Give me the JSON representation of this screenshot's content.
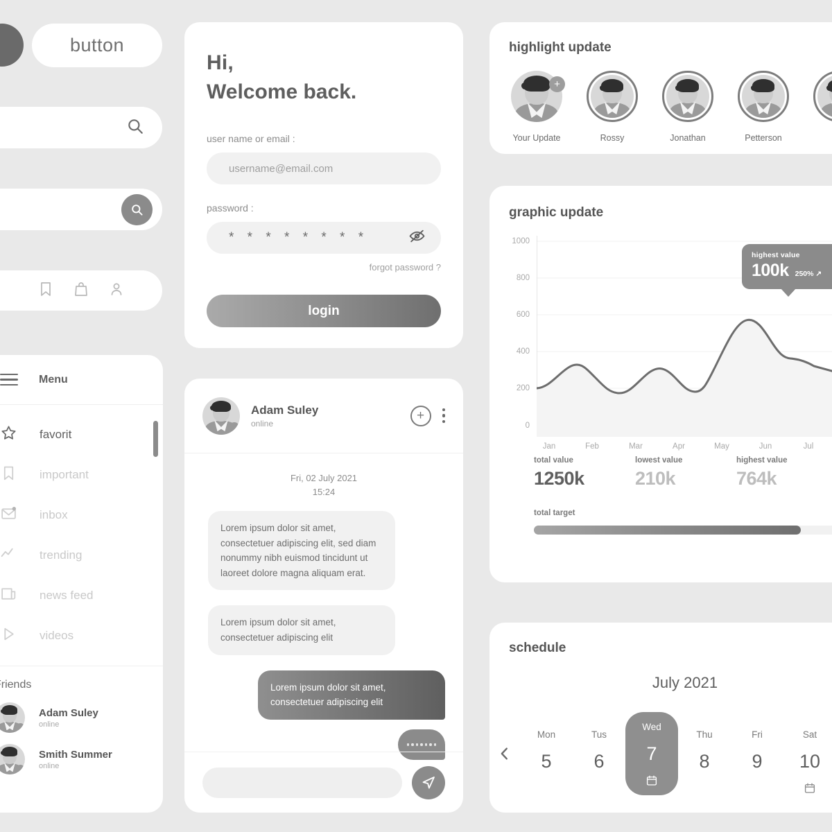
{
  "theme": {
    "bg": "#e9e9e9",
    "card": "#ffffff",
    "accent": "#8b8b8b",
    "text_dark": "#5e5e5e",
    "text_muted": "#a9a9a9"
  },
  "components": {
    "button_label": "button",
    "circle_icon": "dark-circle",
    "search_icon": "search-icon",
    "icon_bar": [
      {
        "name": "bookmark-icon"
      },
      {
        "name": "bag-icon"
      },
      {
        "name": "user-icon"
      }
    ]
  },
  "sidebar": {
    "menu_label": "Menu",
    "items": [
      {
        "label": "favorit",
        "icon": "star-icon",
        "active": true
      },
      {
        "label": "important",
        "icon": "bookmark-icon",
        "active": false
      },
      {
        "label": "inbox",
        "icon": "mail-icon",
        "active": false
      },
      {
        "label": "trending",
        "icon": "trending-icon",
        "active": false
      },
      {
        "label": "news feed",
        "icon": "news-icon",
        "active": false
      },
      {
        "label": "videos",
        "icon": "play-icon",
        "active": false
      }
    ],
    "friends_title": "Friends",
    "friends": [
      {
        "name": "Adam Suley",
        "status": "online"
      },
      {
        "name": "Smith Summer",
        "status": "online"
      }
    ]
  },
  "login": {
    "greeting_line1": "Hi,",
    "greeting_line2": "Welcome back.",
    "username_label": "user name or email :",
    "username_value": "username@email.com",
    "password_label": "password :",
    "password_value": "* * * * * * * *",
    "eye_icon": "eye-off-icon",
    "forgot_label": "forgot password ?",
    "login_label": "login"
  },
  "chat": {
    "name": "Adam Suley",
    "status": "online",
    "add_icon": "plus-circle-icon",
    "menu_icon": "kebab-menu-icon",
    "date": "Fri, 02 July 2021",
    "time": "15:24",
    "messages": [
      {
        "side": "in",
        "text": "Lorem ipsum dolor sit amet, consectetuer adipiscing elit, sed diam nonummy nibh euismod tincidunt ut laoreet dolore magna aliquam erat."
      },
      {
        "side": "in",
        "text": "Lorem ipsum dolor sit amet, consectetuer adipiscing elit"
      },
      {
        "side": "out",
        "text": "Lorem ipsum dolor sit amet, consectetuer adipiscing elit"
      }
    ],
    "typing": true,
    "input_placeholder": "",
    "send_icon": "send-icon"
  },
  "highlight": {
    "title": "highlight update",
    "items": [
      {
        "name": "Your Update",
        "ring": false,
        "badge": "+"
      },
      {
        "name": "Rossy",
        "ring": true
      },
      {
        "name": "Jonathan",
        "ring": true
      },
      {
        "name": "Petterson",
        "ring": true
      },
      {
        "name": "",
        "ring": true
      }
    ]
  },
  "graphic": {
    "title": "graphic update",
    "tooltip": {
      "label": "highest value",
      "value": "100k",
      "delta": "250% ↗"
    },
    "stats": [
      {
        "label": "total value",
        "value": "1250k",
        "tone": "dark"
      },
      {
        "label": "lowest value",
        "value": "210k",
        "tone": "light"
      },
      {
        "label": "highest value",
        "value": "764k",
        "tone": "light"
      }
    ],
    "target_label": "total target",
    "target_percent": 88
  },
  "chart_data": {
    "type": "area",
    "title": "graphic update",
    "xlabel": "",
    "ylabel": "",
    "x": [
      "Jan",
      "Feb",
      "Mar",
      "Apr",
      "May",
      "Jun",
      "Jul"
    ],
    "tick_labels_y": [
      0,
      200,
      400,
      600,
      800,
      1000
    ],
    "ylim": [
      0,
      1100
    ],
    "grid": true,
    "legend": "none",
    "series": [
      {
        "name": "value",
        "values": [
          205,
          310,
          205,
          325,
          220,
          670,
          470
        ]
      }
    ],
    "annotations": [
      {
        "text": "highest value 100k 250% ↗",
        "at_x": "Jun",
        "at_y": 670
      }
    ]
  },
  "schedule": {
    "title": "schedule",
    "month": "July 2021",
    "prev_icon": "chevron-left-icon",
    "days": [
      {
        "dow": "Mon",
        "num": "5",
        "selected": false,
        "has_event": false
      },
      {
        "dow": "Tus",
        "num": "6",
        "selected": false,
        "has_event": false
      },
      {
        "dow": "Wed",
        "num": "7",
        "selected": true,
        "has_event": true
      },
      {
        "dow": "Thu",
        "num": "8",
        "selected": false,
        "has_event": false
      },
      {
        "dow": "Fri",
        "num": "9",
        "selected": false,
        "has_event": false
      },
      {
        "dow": "Sat",
        "num": "10",
        "selected": false,
        "has_event": true
      }
    ]
  }
}
